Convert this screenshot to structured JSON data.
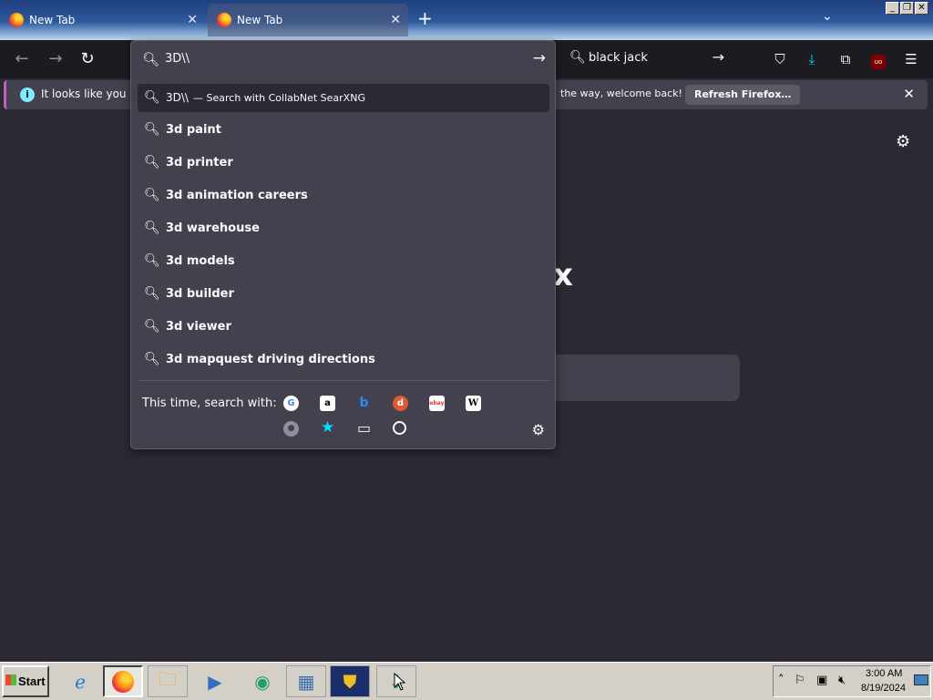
{
  "tabs": [
    {
      "label": "New Tab",
      "close": "✕"
    },
    {
      "label": "New Tab",
      "close": "✕"
    }
  ],
  "tabbar": {
    "new_tab": "+",
    "list_all": "⌄"
  },
  "window_controls": {
    "minimize": "_",
    "restore": "❐",
    "close": "✕"
  },
  "nav": {
    "back": "←",
    "forward": "→",
    "reload": "↻"
  },
  "search_bar": {
    "value": "black jack",
    "go": "→"
  },
  "urlbar": {
    "value": "3D\\\\",
    "go": "→"
  },
  "notification": {
    "message_start": "It looks like you have",
    "message_end": "the way, welcome back!",
    "button": "Refresh Firefox…",
    "close": "✕"
  },
  "page": {
    "big_text_fragment": "x"
  },
  "dropdown": {
    "heuristic": {
      "query": "3D\\\\",
      "label": "— Search with CollabNet SearXNG"
    },
    "suggestions": [
      "3d paint",
      "3d printer",
      "3d animation careers",
      "3d warehouse",
      "3d models",
      "3d builder",
      "3d viewer",
      "3d mapquest driving directions"
    ],
    "oneoff_label": "This time, search with:",
    "engines": [
      {
        "name": "google-icon",
        "glyph": "G"
      },
      {
        "name": "amazon-icon",
        "glyph": "a"
      },
      {
        "name": "bing-icon",
        "glyph": "b"
      },
      {
        "name": "duckduckgo-icon",
        "glyph": "d"
      },
      {
        "name": "ebay-icon",
        "glyph": "ebay"
      },
      {
        "name": "wikipedia-icon",
        "glyph": "W"
      }
    ],
    "modes": [
      {
        "name": "searxng-icon",
        "glyph": "🔍"
      },
      {
        "name": "bookmarks-icon",
        "glyph": "★"
      },
      {
        "name": "tabs-icon",
        "glyph": "▭"
      },
      {
        "name": "history-icon",
        "glyph": "🕒"
      }
    ]
  },
  "taskbar": {
    "start": "Start",
    "clock_time": "3:00 AM",
    "clock_date": "8/19/2024"
  },
  "colors": {
    "accent": "#80ebff",
    "highlight": "#00ddff"
  }
}
